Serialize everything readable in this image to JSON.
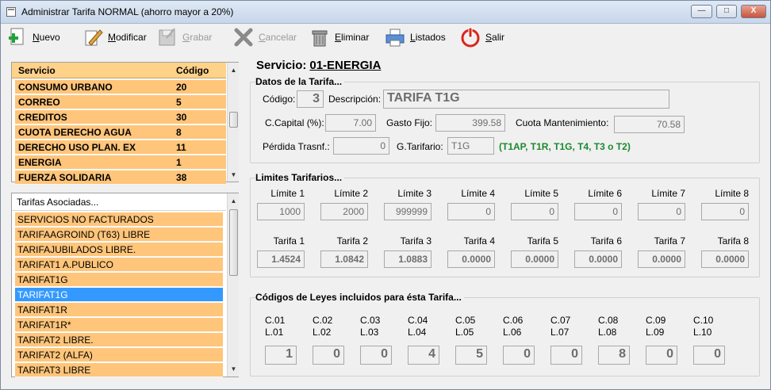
{
  "window": {
    "title": "Administrar Tarifa NORMAL (ahorro mayor a 20%)",
    "controls": {
      "minimize": "—",
      "maximize": "□",
      "close": "X"
    }
  },
  "toolbar": {
    "nuevo": "Nuevo",
    "modificar": "Modificar",
    "grabar": "Grabar",
    "cancelar": "Cancelar",
    "eliminar": "Eliminar",
    "listados": "Listados",
    "salir": "Salir"
  },
  "services_grid": {
    "headers": {
      "servicio": "Servicio",
      "codigo": "Código"
    },
    "rows": [
      {
        "servicio": "CONSUMO URBANO",
        "codigo": "20"
      },
      {
        "servicio": "CORREO",
        "codigo": "5"
      },
      {
        "servicio": "CREDITOS",
        "codigo": "30"
      },
      {
        "servicio": "CUOTA DERECHO AGUA",
        "codigo": "8"
      },
      {
        "servicio": "DERECHO USO PLAN. EX",
        "codigo": "11"
      },
      {
        "servicio": "ENERGIA",
        "codigo": "1"
      },
      {
        "servicio": "FUERZA SOLIDARIA",
        "codigo": "38"
      }
    ]
  },
  "tarifas_list": {
    "header": "Tarifas Asociadas...",
    "items": [
      "SERVICIOS NO FACTURADOS",
      "TARIFAAGROIND (T63)  LIBRE",
      "TARIFAJUBILADOS   LIBRE.",
      "TARIFAT1 A.PUBLICO",
      "TARIFAT1G",
      "TARIFAT1G",
      "TARIFAT1R",
      "TARIFAT1R*",
      "TARIFAT2   LIBRE.",
      "TARIFAT2 (ALFA)",
      "TARIFAT3  LIBRE"
    ],
    "selected_index": 5
  },
  "servicio": {
    "label": "Servicio:",
    "value": "01-ENERGIA"
  },
  "datos": {
    "title": "Datos de la Tarifa...",
    "codigo_label": "Código:",
    "codigo": "3",
    "descripcion_label": "Descripción:",
    "descripcion": "TARIFA T1G",
    "capital_label": "C.Capital (%):",
    "capital": "7.00",
    "gasto_label": "Gasto Fijo:",
    "gasto": "399.58",
    "cuota_label": "Cuota Mantenimiento:",
    "cuota": "70.58",
    "perdida_label": "Pérdida Trasnf.:",
    "perdida": "0",
    "gtarifario_label": "G.Tarifario:",
    "gtarifario": "T1G",
    "gtarifario_hint": "(T1AP, T1R, T1G, T4, T3 o T2)"
  },
  "limites": {
    "title": "Limites Tarifarios...",
    "limit_labels": [
      "Límite 1",
      "Límite 2",
      "Límite 3",
      "Límite 4",
      "Límite 5",
      "Límite 6",
      "Límite 7",
      "Límite 8"
    ],
    "limit_values": [
      "1000",
      "2000",
      "999999",
      "0",
      "0",
      "0",
      "0",
      "0"
    ],
    "tarifa_labels": [
      "Tarifa 1",
      "Tarifa 2",
      "Tarifa 3",
      "Tarifa 4",
      "Tarifa 5",
      "Tarifa 6",
      "Tarifa 7",
      "Tarifa 8"
    ],
    "tarifa_values": [
      "1.4524",
      "1.0842",
      "1.0883",
      "0.0000",
      "0.0000",
      "0.0000",
      "0.0000",
      "0.0000"
    ]
  },
  "leyes": {
    "title": "Códigos de Leyes incluidos para ésta Tarifa...",
    "c_labels": [
      "C.01",
      "C.02",
      "C.03",
      "C.04",
      "C.05",
      "C.06",
      "C.07",
      "C.08",
      "C.09",
      "C.10"
    ],
    "l_labels": [
      "L.01",
      "L.02",
      "L.03",
      "L.04",
      "L.05",
      "L.06",
      "L.07",
      "L.08",
      "L.09",
      "L.10"
    ],
    "values": [
      "1",
      "0",
      "0",
      "4",
      "5",
      "0",
      "0",
      "8",
      "0",
      "0"
    ]
  }
}
